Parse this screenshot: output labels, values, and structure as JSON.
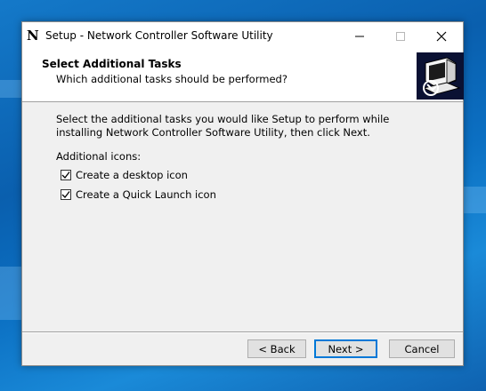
{
  "window": {
    "title": "Setup - Network Controller Software Utility",
    "app_icon_glyph": "N"
  },
  "header": {
    "title": "Select Additional Tasks",
    "subtitle": "Which additional tasks should be performed?"
  },
  "main": {
    "description": "Select the additional tasks you would like Setup to perform while installing Network Controller Software Utility, then click Next.",
    "group_label": "Additional icons:",
    "tasks": [
      {
        "label": "Create a desktop icon",
        "checked": true
      },
      {
        "label": "Create a Quick Launch icon",
        "checked": true
      }
    ]
  },
  "footer": {
    "back_label": "< Back",
    "next_label": "Next >",
    "cancel_label": "Cancel"
  },
  "colors": {
    "accent": "#0078d7",
    "desktop_bg": "#0b6fc2",
    "dialog_bg": "#f0f0f0"
  }
}
